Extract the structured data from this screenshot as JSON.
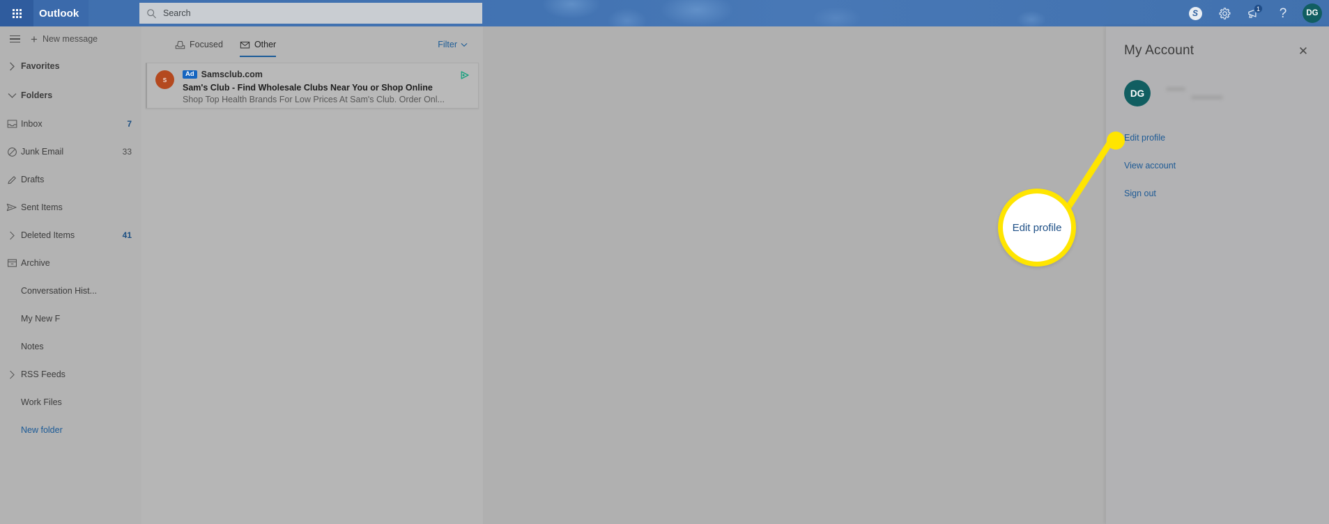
{
  "topbar": {
    "waffle_icon": "app-launcher-grid-icon",
    "brand": "Outlook",
    "search_placeholder": "Search",
    "search_value": "",
    "search_icon": "search-icon",
    "actions": [
      {
        "name": "skype-icon",
        "label": "S"
      },
      {
        "name": "gear-icon",
        "label": ""
      },
      {
        "name": "megaphone-icon",
        "label": "",
        "badge": "1"
      },
      {
        "name": "help-icon",
        "label": "?"
      }
    ],
    "avatar_initials": "DG"
  },
  "sidebar": {
    "hamburger_icon": "hamburger-menu-icon",
    "new_message": "New message",
    "new_message_icon": "plus-icon",
    "favorites": {
      "label": "Favorites",
      "chevron": "chevron-right-icon"
    },
    "folders": {
      "label": "Folders",
      "chevron": "chevron-down-icon"
    },
    "items": [
      {
        "label": "Inbox",
        "count": "7",
        "icon": "inbox-icon",
        "chevron": false,
        "link": false
      },
      {
        "label": "Junk Email",
        "count": "33",
        "icon": "block-icon",
        "chevron": false,
        "link": false
      },
      {
        "label": "Drafts",
        "count": "",
        "icon": "pencil-icon",
        "chevron": false,
        "link": false
      },
      {
        "label": "Sent Items",
        "count": "",
        "icon": "send-icon",
        "chevron": false,
        "link": false
      },
      {
        "label": "Deleted Items",
        "count": "41",
        "icon": "",
        "chevron": true,
        "link": false
      },
      {
        "label": "Archive",
        "count": "",
        "icon": "archive-icon",
        "chevron": false,
        "link": false
      },
      {
        "label": "Conversation Hist...",
        "count": "",
        "icon": "",
        "chevron": false,
        "link": false
      },
      {
        "label": "My New F",
        "count": "",
        "icon": "",
        "chevron": false,
        "link": false
      },
      {
        "label": "Notes",
        "count": "",
        "icon": "",
        "chevron": false,
        "link": false
      },
      {
        "label": "RSS Feeds",
        "count": "",
        "icon": "",
        "chevron": true,
        "link": false
      },
      {
        "label": "Work Files",
        "count": "",
        "icon": "",
        "chevron": false,
        "link": false
      },
      {
        "label": "New folder",
        "count": "",
        "icon": "",
        "chevron": false,
        "link": true
      }
    ]
  },
  "message_list": {
    "tabs": [
      {
        "label": "Focused",
        "icon": "focused-inbox-icon",
        "active": false
      },
      {
        "label": "Other",
        "icon": "other-inbox-icon",
        "active": true
      }
    ],
    "filter_label": "Filter",
    "filter_chevron": "chevron-down-icon",
    "messages": [
      {
        "avatar_initial": "s",
        "ad_badge": "Ad",
        "sender": "Samsclub.com",
        "subject": "Sam's Club - Find Wholesale Clubs Near You or Shop Online",
        "preview": "Shop Top Health Brands For Low Prices At Sam's Club. Order Onl...",
        "adchoices_icon": "adchoices-icon"
      }
    ]
  },
  "account_panel": {
    "title": "My Account",
    "close_icon": "close-icon",
    "avatar_initials": "DG",
    "links": [
      {
        "label": "Edit profile",
        "name": "edit-profile-link"
      },
      {
        "label": "View account",
        "name": "view-account-link"
      },
      {
        "label": "Sign out",
        "name": "sign-out-link"
      }
    ]
  },
  "annotation": {
    "callout_label": "Edit profile",
    "highlight_color": "#ffe500",
    "text_color": "#1d4f86"
  },
  "colors": {
    "brand_blue": "#2f5c9e",
    "header_blue": "#3c6ead",
    "accent_link": "#1d5a95",
    "avatar_teal": "#115e61",
    "ad_badge_blue": "#1565c0",
    "sender_avatar_orange": "#b4491f",
    "tab_underline": "#1a5b98",
    "highlight_yellow": "#ffe500"
  }
}
